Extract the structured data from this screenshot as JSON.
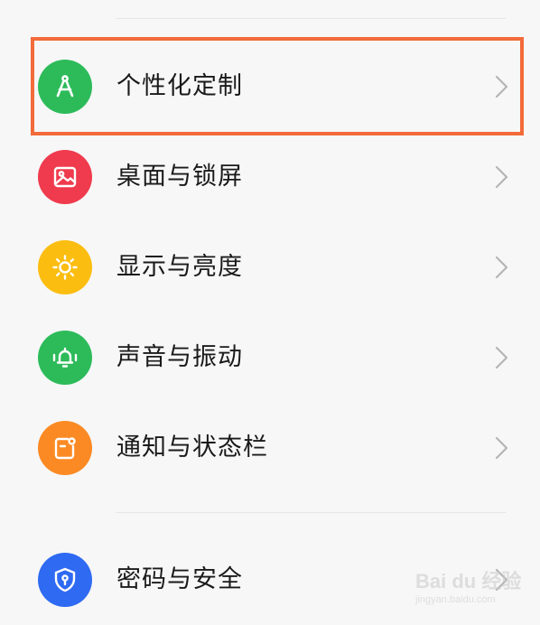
{
  "settings_list": {
    "items": [
      {
        "label": "个性化定制",
        "icon": "compass-icon",
        "color": "#2dbb5a"
      },
      {
        "label": "桌面与锁屏",
        "icon": "image-icon",
        "color": "#ef3b4d"
      },
      {
        "label": "显示与亮度",
        "icon": "sun-icon",
        "color": "#fbbd10"
      },
      {
        "label": "声音与振动",
        "icon": "bell-vibrate-icon",
        "color": "#2dbb5a"
      },
      {
        "label": "通知与状态栏",
        "icon": "notification-icon",
        "color": "#fb8a24"
      },
      {
        "label": "密码与安全",
        "icon": "shield-lock-icon",
        "color": "#2f6af2"
      }
    ]
  },
  "highlight": {
    "color": "#f26b3a"
  },
  "watermark": {
    "text": "Bai du 经验",
    "sub": "jingyan.baidu.com"
  }
}
